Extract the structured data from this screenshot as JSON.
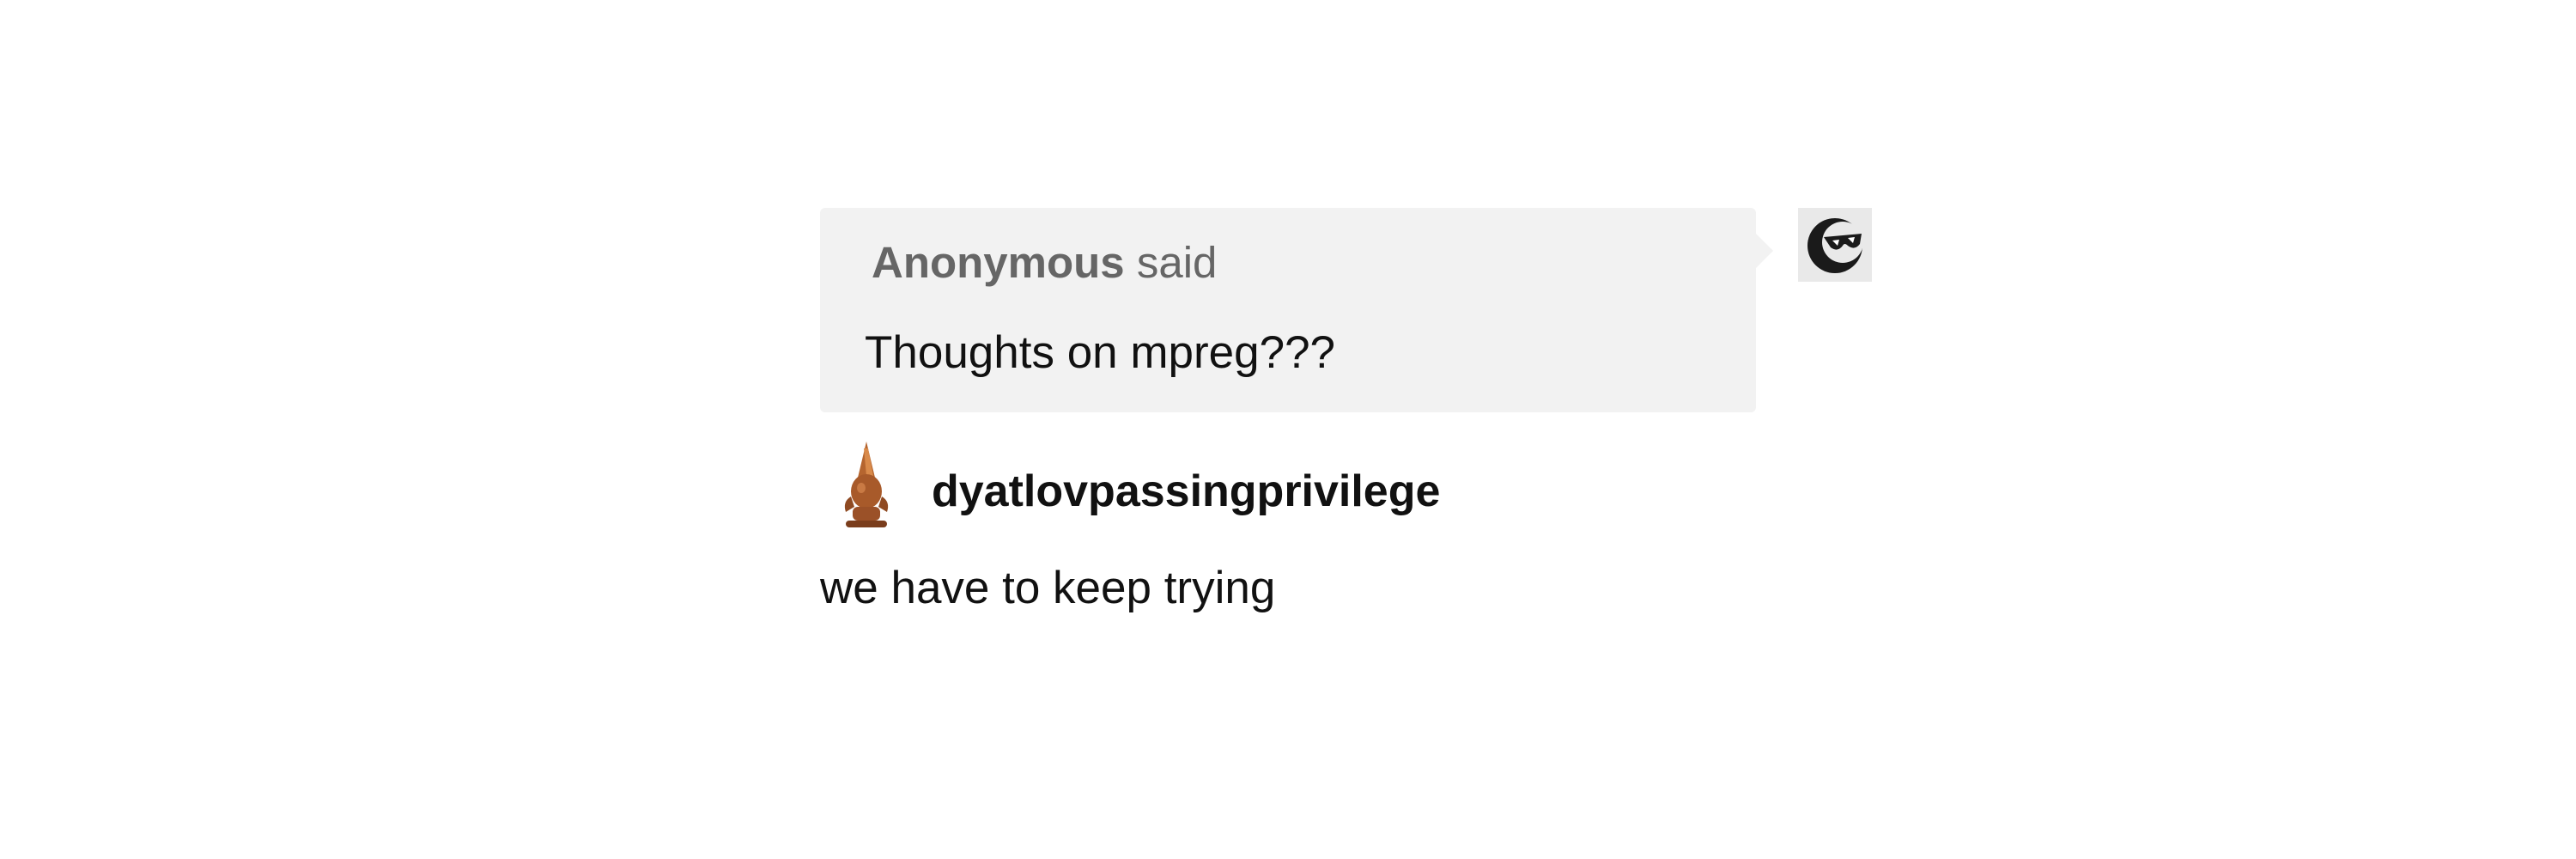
{
  "ask": {
    "asker_name": "Anonymous",
    "asker_verb": "said",
    "question": "Thoughts on mpreg???",
    "asker_avatar_icon": "sunglasses-face-icon"
  },
  "answer": {
    "answerer_name": "dyatlovpassingprivilege",
    "answerer_avatar_icon": "gnome-figurine-icon",
    "text": "we have to keep trying"
  },
  "colors": {
    "ask_background": "#f2f2f2",
    "asker_text": "#666666",
    "body_text": "#111111",
    "page_background": "#ffffff"
  }
}
